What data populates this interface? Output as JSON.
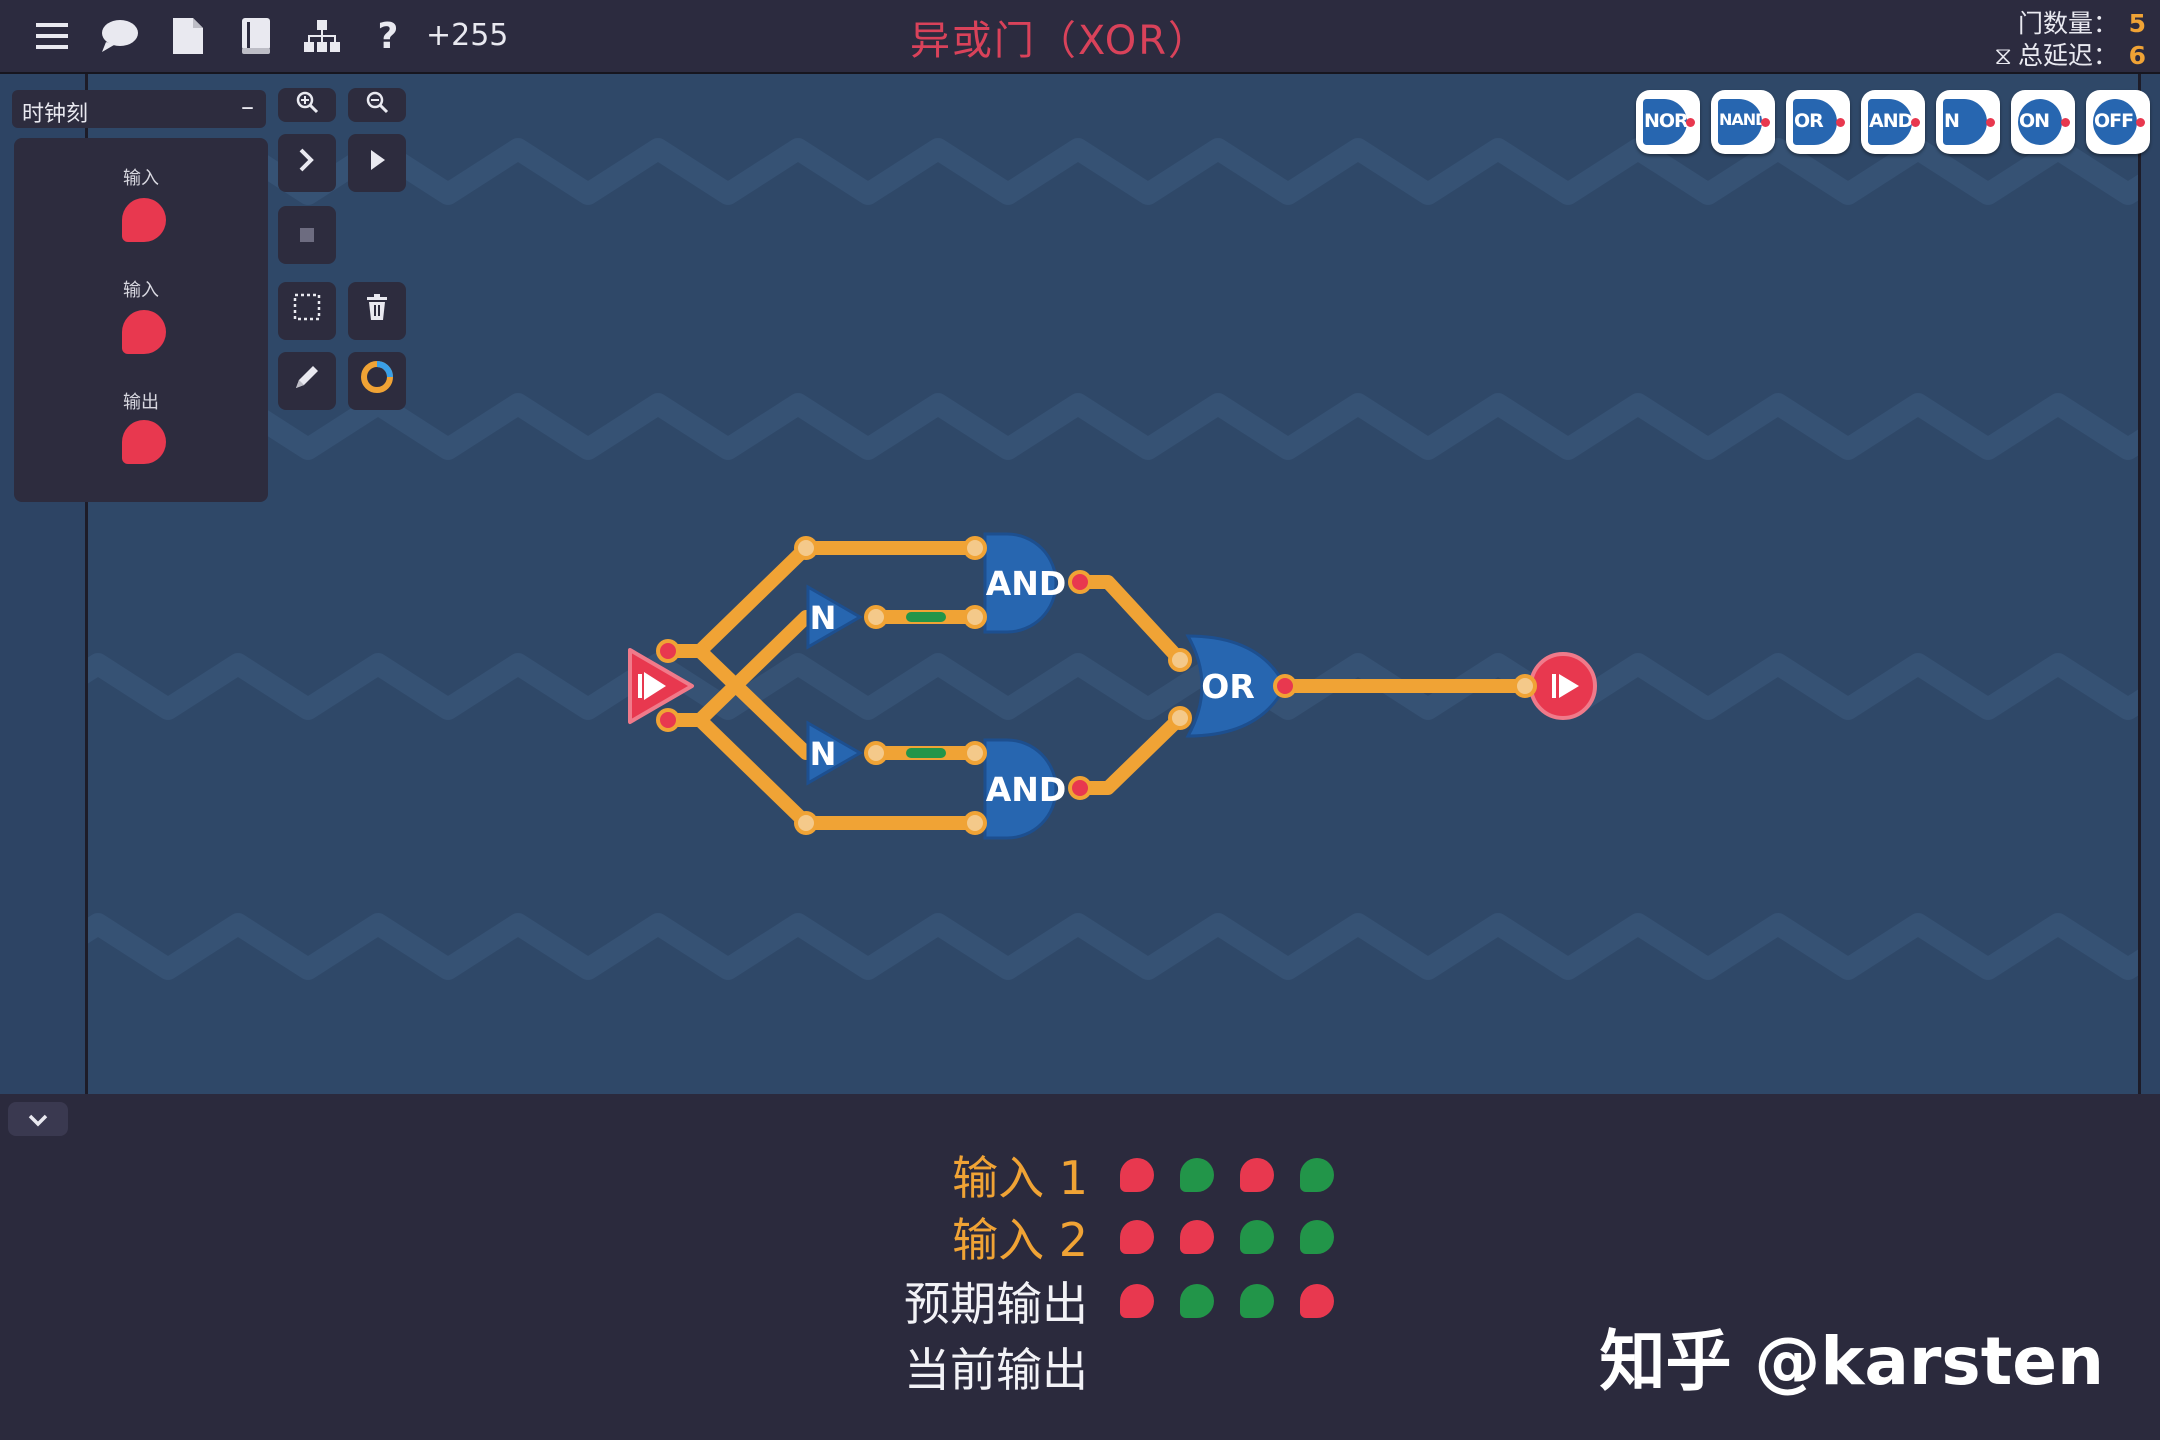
{
  "topbar": {
    "score": "+255",
    "title": "异或门（XOR）",
    "gate_count_label": "门数量：",
    "gate_count": "5",
    "delay_label": "总延迟：",
    "delay": "6",
    "icons": [
      "menu-icon",
      "chat-icon",
      "file-icon",
      "book-icon",
      "hierarchy-icon",
      "help-icon"
    ]
  },
  "sidebar": {
    "clock_select": "时钟刻",
    "clock_minus": "–",
    "io": [
      {
        "label": "输入"
      },
      {
        "label": "输入"
      },
      {
        "label": "输出"
      }
    ]
  },
  "tools": [
    "zoom-in-icon",
    "zoom-out-icon",
    "step-icon",
    "play-icon",
    "stop-icon",
    "select-icon",
    "trash-icon",
    "pencil-icon",
    "color-ring-icon"
  ],
  "palette": [
    {
      "label": "NOR"
    },
    {
      "label": "NAND"
    },
    {
      "label": "OR"
    },
    {
      "label": "AND"
    },
    {
      "label": "N"
    },
    {
      "label": "ON"
    },
    {
      "label": "OFF"
    }
  ],
  "circuit": {
    "gates": [
      {
        "label": "AND"
      },
      {
        "label": "AND"
      },
      {
        "label": "N"
      },
      {
        "label": "N"
      },
      {
        "label": "OR"
      }
    ]
  },
  "truth_table": {
    "rows": [
      {
        "label": "输入 1",
        "values": [
          "red",
          "green",
          "red",
          "green"
        ]
      },
      {
        "label": "输入 2",
        "values": [
          "red",
          "red",
          "green",
          "green"
        ]
      },
      {
        "label": "预期输出",
        "values": [
          "red",
          "green",
          "green",
          "red"
        ]
      },
      {
        "label": "当前输出",
        "values": []
      }
    ]
  },
  "watermark": "知乎 @karsten",
  "colors": {
    "wire": "#f0a335",
    "gate": "#2766b0",
    "signal_off": "#e8384f",
    "signal_on": "#229549",
    "canvas": "#2f4868"
  }
}
